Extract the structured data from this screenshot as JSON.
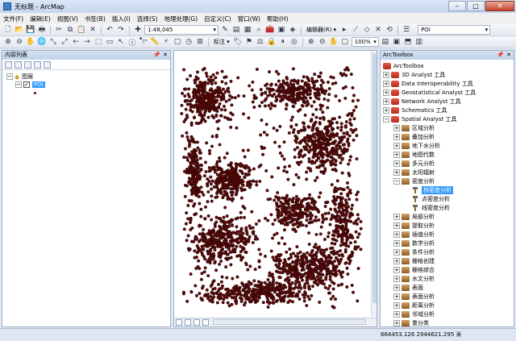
{
  "window": {
    "title": "无标题 - ArcMap",
    "minimize": "–",
    "maximize": "□",
    "close": "✕"
  },
  "menu": [
    "文件(F)",
    "编辑(E)",
    "视图(V)",
    "书签(B)",
    "插入(I)",
    "选择(S)",
    "地理处理(G)",
    "自定义(C)",
    "窗口(W)",
    "帮助(H)"
  ],
  "toolbar": {
    "scale": "1:48,045",
    "editor_label": "编辑器(R) ▾",
    "layer_select": "POI",
    "label_label": "标注 ▾",
    "zoom_percent": "100%"
  },
  "toc": {
    "title": "内容列表",
    "pin": "📌",
    "close": "✕",
    "root_label": "图层",
    "layer_label": "POI",
    "layer_checked": true
  },
  "toolbox": {
    "title": "ArcToolbox",
    "pin": "📌",
    "close": "✕",
    "root": "ArcToolbox",
    "items": [
      {
        "label": "3D Analyst 工具",
        "depth": 1,
        "expander": "+",
        "icon": "red"
      },
      {
        "label": "Data Interoperability 工具",
        "depth": 1,
        "expander": "+",
        "icon": "red"
      },
      {
        "label": "Geostatistical Analyst 工具",
        "depth": 1,
        "expander": "+",
        "icon": "red"
      },
      {
        "label": "Network Analyst 工具",
        "depth": 1,
        "expander": "+",
        "icon": "red"
      },
      {
        "label": "Schematics 工具",
        "depth": 1,
        "expander": "+",
        "icon": "red"
      },
      {
        "label": "Spatial Analyst 工具",
        "depth": 1,
        "expander": "−",
        "icon": "red"
      },
      {
        "label": "区域分析",
        "depth": 2,
        "expander": "+",
        "icon": "brown"
      },
      {
        "label": "叠加分析",
        "depth": 2,
        "expander": "+",
        "icon": "brown"
      },
      {
        "label": "地下水分析",
        "depth": 2,
        "expander": "+",
        "icon": "brown"
      },
      {
        "label": "地图代数",
        "depth": 2,
        "expander": "+",
        "icon": "brown"
      },
      {
        "label": "多元分析",
        "depth": 2,
        "expander": "+",
        "icon": "brown"
      },
      {
        "label": "太阳辐射",
        "depth": 2,
        "expander": "+",
        "icon": "brown"
      },
      {
        "label": "密度分析",
        "depth": 2,
        "expander": "−",
        "icon": "brown"
      },
      {
        "label": "核密度分析",
        "depth": 3,
        "expander": "",
        "icon": "hammer",
        "selected": true
      },
      {
        "label": "点密度分析",
        "depth": 3,
        "expander": "",
        "icon": "hammer"
      },
      {
        "label": "线密度分析",
        "depth": 3,
        "expander": "",
        "icon": "hammer"
      },
      {
        "label": "局部分析",
        "depth": 2,
        "expander": "+",
        "icon": "brown"
      },
      {
        "label": "提取分析",
        "depth": 2,
        "expander": "+",
        "icon": "brown"
      },
      {
        "label": "插值分析",
        "depth": 2,
        "expander": "+",
        "icon": "brown"
      },
      {
        "label": "数学分析",
        "depth": 2,
        "expander": "+",
        "icon": "brown"
      },
      {
        "label": "条件分析",
        "depth": 2,
        "expander": "+",
        "icon": "brown"
      },
      {
        "label": "栅格创建",
        "depth": 2,
        "expander": "+",
        "icon": "brown"
      },
      {
        "label": "栅格综合",
        "depth": 2,
        "expander": "+",
        "icon": "brown"
      },
      {
        "label": "水文分析",
        "depth": 2,
        "expander": "+",
        "icon": "brown"
      },
      {
        "label": "表面",
        "depth": 2,
        "expander": "+",
        "icon": "brown"
      },
      {
        "label": "表面分析",
        "depth": 2,
        "expander": "+",
        "icon": "brown"
      },
      {
        "label": "距离分析",
        "depth": 2,
        "expander": "+",
        "icon": "brown"
      },
      {
        "label": "邻域分析",
        "depth": 2,
        "expander": "+",
        "icon": "brown"
      },
      {
        "label": "重分类",
        "depth": 2,
        "expander": "+",
        "icon": "brown"
      }
    ]
  },
  "map": {
    "point_color": "#5c0a0a",
    "point_outline": "#1a0000"
  },
  "status": {
    "coords": "664453.126  2944621.295 米"
  }
}
